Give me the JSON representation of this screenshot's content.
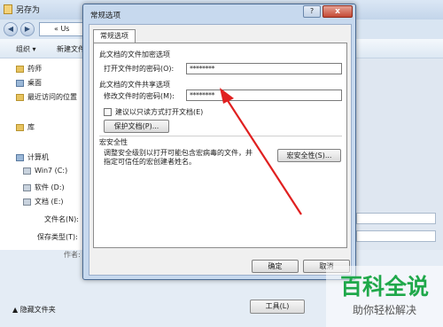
{
  "bg_window": {
    "title": "另存为",
    "address_partial": "« Us",
    "toolbar": {
      "organize": "组织 ▾",
      "new_folder": "新建文件"
    },
    "sidebar": [
      {
        "label": "药师",
        "icon": "folder-icon"
      },
      {
        "label": "桌面",
        "icon": "desktop-icon"
      },
      {
        "label": "最近访问的位置",
        "icon": "recent-icon"
      },
      {
        "label": "库",
        "icon": "library-icon"
      },
      {
        "label": "计算机",
        "icon": "computer-icon"
      },
      {
        "label": "Win7 (C:)",
        "icon": "drive-icon"
      },
      {
        "label": "软件 (D:)",
        "icon": "drive-icon"
      },
      {
        "label": "文档 (E:)",
        "icon": "drive-icon"
      }
    ],
    "filename_label": "文件名(N):",
    "savetype_label": "保存类型(T):",
    "author_label": "作者:",
    "hide_folders": "隐藏文件夹",
    "tools_button": "工具(L)"
  },
  "dialog": {
    "title": "常规选项",
    "help_icon": "?",
    "close_icon": "x",
    "tab": "常规选项",
    "encrypt_section": "此文档的文件加密选项",
    "open_password_label": "打开文件时的密码(O):",
    "open_password_value": "********",
    "share_section": "此文档的文件共享选项",
    "modify_password_label": "修改文件时的密码(M):",
    "modify_password_value": "********",
    "readonly_checkbox": "建议以只读方式打开文档(E)",
    "protect_button": "保护文档(P)...",
    "macro_section": "宏安全性",
    "macro_text_line1": "调整安全级别以打开可能包含宏病毒的文件，并",
    "macro_text_line2": "指定可信任的宏创建者姓名。",
    "macro_button": "宏安全性(S)...",
    "ok_button": "确定",
    "cancel_button": "取消"
  },
  "watermark": {
    "title": "百科全说",
    "subtitle": "助你轻松解决"
  },
  "colors": {
    "arrow": "#e02020",
    "watermark_green": "#1fa84a"
  }
}
